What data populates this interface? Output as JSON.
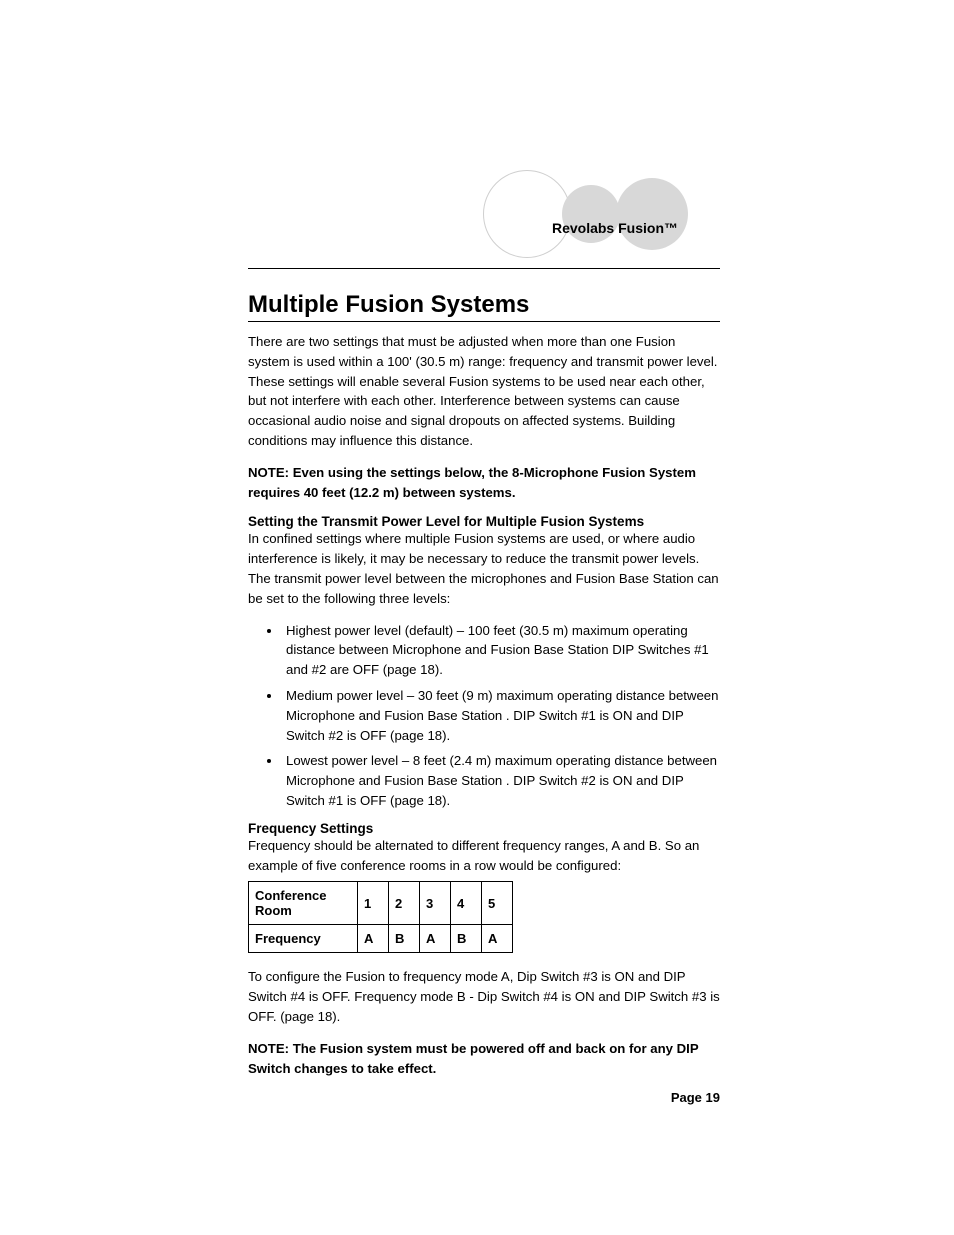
{
  "header": {
    "product_name": "Revolabs Fusion™"
  },
  "title": "Multiple Fusion Systems",
  "intro": "There are two settings that must be adjusted when more than one Fusion system is used within a 100' (30.5 m) range:  frequency and transmit power level.  These settings will enable several Fusion systems to be used near each other, but not interfere with each other.  Interference between systems can cause occasional audio noise and signal dropouts on affected systems.  Building conditions may influence this distance.",
  "note1_label": "NOTE",
  "note1_text": ":  Even using the settings below, the 8-Microphone Fusion System requires 40 feet (12.2 m) between systems.",
  "section1": {
    "heading": "Setting the Transmit Power Level for Multiple Fusion Systems",
    "intro": "In confined settings where multiple Fusion systems are used, or where audio interference is likely, it may be necessary to reduce the transmit power levels. The transmit power level between the microphones and Fusion Base Station can be set to the following three levels:",
    "bullets": [
      "Highest power level (default) – 100 feet (30.5 m) maximum operating distance between Microphone and Fusion Base Station DIP Switches #1 and #2 are OFF (page 18).",
      "Medium power level – 30 feet (9 m) maximum operating distance between Microphone and Fusion Base Station .  DIP Switch #1 is ON and DIP Switch #2 is OFF  (page 18).",
      "Lowest power level – 8 feet (2.4 m) maximum operating distance between Microphone and Fusion Base Station . DIP Switch #2 is ON and DIP Switch #1 is OFF (page 18)."
    ]
  },
  "section2": {
    "heading": "Frequency Settings",
    "intro": "Frequency should be alternated to different frequency ranges, A and B.  So an example of five conference rooms in a row would be configured:",
    "table": {
      "row1_label": "Conference Room",
      "row2_label": "Frequency",
      "cols": [
        "1",
        "2",
        "3",
        "4",
        "5"
      ],
      "freqs": [
        "A",
        "B",
        "A",
        "B",
        "A"
      ]
    },
    "after_table": "To configure the Fusion to frequency mode A, Dip Switch #3 is ON and DIP Switch #4 is OFF.  Frequency mode B - Dip Switch #4 is ON and DIP Switch #3 is OFF. (page 18)."
  },
  "note2": "NOTE:  The Fusion system must be powered off and back on for any DIP Switch changes to take effect.",
  "page_number": "Page 19",
  "chart_data": {
    "type": "table",
    "title": "Frequency assignment by conference room",
    "columns": [
      "Conference Room",
      "1",
      "2",
      "3",
      "4",
      "5"
    ],
    "rows": [
      [
        "Frequency",
        "A",
        "B",
        "A",
        "B",
        "A"
      ]
    ]
  }
}
